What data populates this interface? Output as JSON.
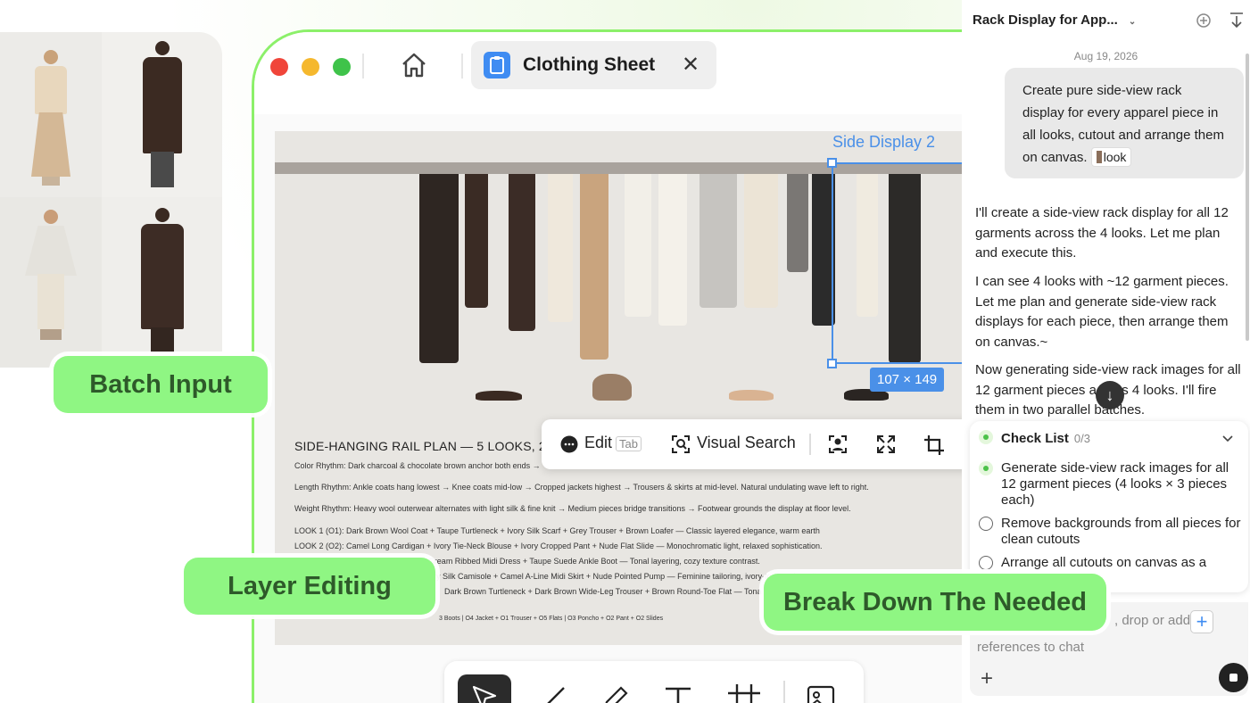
{
  "labels": {
    "batch_input": "Batch Input",
    "layer_editing": "Layer Editing",
    "break_down": "Break Down The Needed"
  },
  "window": {
    "tab_title": "Clothing Sheet",
    "close_symbol": "✕",
    "traffic_colors": [
      "#f0453a",
      "#f5b82e",
      "#3fc34a"
    ]
  },
  "canvas": {
    "selection_label": "Side Display 2",
    "dimensions": "107 × 149",
    "plan_title": "SIDE-HANGING RAIL PLAN — 5 LOOKS, 20",
    "plan_lines_a": [
      "Color Rhythm: Dark charcoal & chocolate brown anchor both ends →",
      "Length Rhythm: Ankle coats hang lowest → Knee coats mid-low → Cropped jackets highest → Trousers & skirts at mid-level. Natural undulating wave left to right.",
      "Weight Rhythm: Heavy wool outerwear alternates with light silk & fine knit → Medium pieces bridge transitions → Footwear grounds the display at floor level."
    ],
    "plan_lines_b": [
      "LOOK 1 (O1): Dark Brown Wool Coat + Taupe Turtleneck + Ivory Silk Scarf + Grey Trouser + Brown Loafer — Classic layered elegance, warm earth",
      "LOOK 2 (O2): Camel Long Cardigan + Ivory Tie-Neck Blouse + Ivory Cropped Pant + Nude Flat Slide — Monochromatic light, relaxed sophistication.",
      "LOOK 3 (O3): Cream/Grey Poncho + Cream Ribbed Midi Dress + Taupe Suede Ankle Boot — Tonal layering, cozy texture contrast.",
      "ry Silk Camisole + Camel A-Line Midi Skirt + Nude Pointed Pump — Feminine tailoring, ivory-to-camel gradient.",
      "Dark Brown Turtleneck + Dark Brown Wide-Leg Trouser + Brown Round-Toe Flat — Tona"
    ],
    "plan_footer": "3 Boots | O4 Jacket + O1 Trouser + O5 Flats | O3 Poncho + O2 Pant + O2 Slides"
  },
  "float_toolbar": {
    "edit": "Edit",
    "edit_key": "Tab",
    "visual_search": "Visual Search"
  },
  "panel": {
    "title": "Rack Display for App...",
    "date": "Aug 19, 2026",
    "user_message": "Create pure side-view rack display for every apparel piece in all looks, cutout and arrange them on canvas.",
    "chip_label": "look",
    "paragraphs": [
      "I'll create a side-view rack display for all 12 garments across the 4 looks. Let me plan and execute this.",
      "I can see 4 looks with ~12 garment pieces. Let me plan and generate side-view rack displays for each piece, then arrange them on canvas.~",
      "Now generating side-view rack images for all 12 garment pieces across 4 looks. I'll fire them in two parallel batches."
    ],
    "checklist_title": "Check List",
    "checklist_count": "0/3",
    "checklist": [
      "Generate side-view rack images for all 12 garment pieces (4 looks × 3 pieces each)",
      "Remove backgrounds from all pieces for clean cutouts",
      "Arrange all cutouts on canvas as a"
    ],
    "input_placeholder_1": ", drop or add",
    "input_placeholder_2": "references to chat",
    "plus_symbol": "+"
  }
}
